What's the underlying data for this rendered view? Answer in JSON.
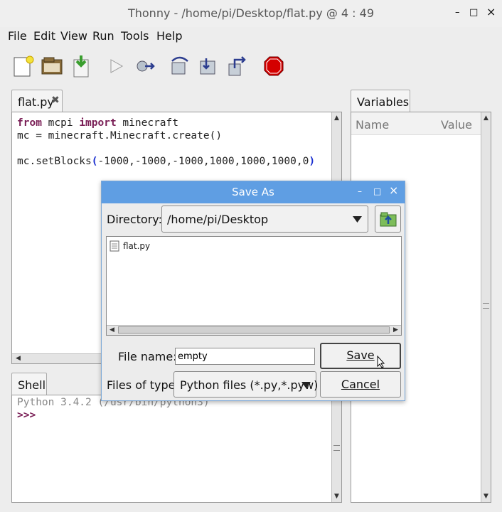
{
  "window": {
    "title": "Thonny  -  /home/pi/Desktop/flat.py  @  4 : 49",
    "minimize": "–",
    "maximize": "□",
    "close": "×"
  },
  "menu": [
    "File",
    "Edit",
    "View",
    "Run",
    "Tools",
    "Help"
  ],
  "toolbar": [
    "new-file-icon",
    "open-file-icon",
    "save-file-icon",
    "run-icon",
    "debug-icon",
    "step-over-icon",
    "step-into-icon",
    "step-out-icon",
    "stop-icon"
  ],
  "editor": {
    "tab": "flat.py",
    "tab_close": "✖",
    "line1": {
      "kw1": "from",
      "t1": " mcpi ",
      "kw2": "import",
      "t2": " minecraft"
    },
    "line2": "mc = minecraft.Minecraft.create()",
    "line4": {
      "pre": "mc.setBlocks",
      "open": "(",
      "args": "-1000,-1000,-1000,1000,1000,1000,0",
      "close": ")"
    }
  },
  "shell": {
    "tab": "Shell",
    "version": "Python 3.4.2 (/usr/bin/python3)",
    "prompt": ">>>"
  },
  "variables": {
    "tab": "Variables",
    "col_name": "Name",
    "col_value": "Value"
  },
  "dialog": {
    "title": "Save As",
    "directory_label": "Directory:",
    "directory_value": "/home/pi/Desktop",
    "files": [
      "flat.py"
    ],
    "filename_label": "File name:",
    "filename_value": "empty",
    "filetype_label": "Files of type:",
    "filetype_value": "Python files (*.py,*.pyw)",
    "save": "Save",
    "cancel": "Cancel"
  },
  "colors": {
    "dialog_title": "#5f9ee3",
    "keyword": "#7a1f56",
    "paren": "#1a2fd0",
    "stop": "#d40000"
  }
}
